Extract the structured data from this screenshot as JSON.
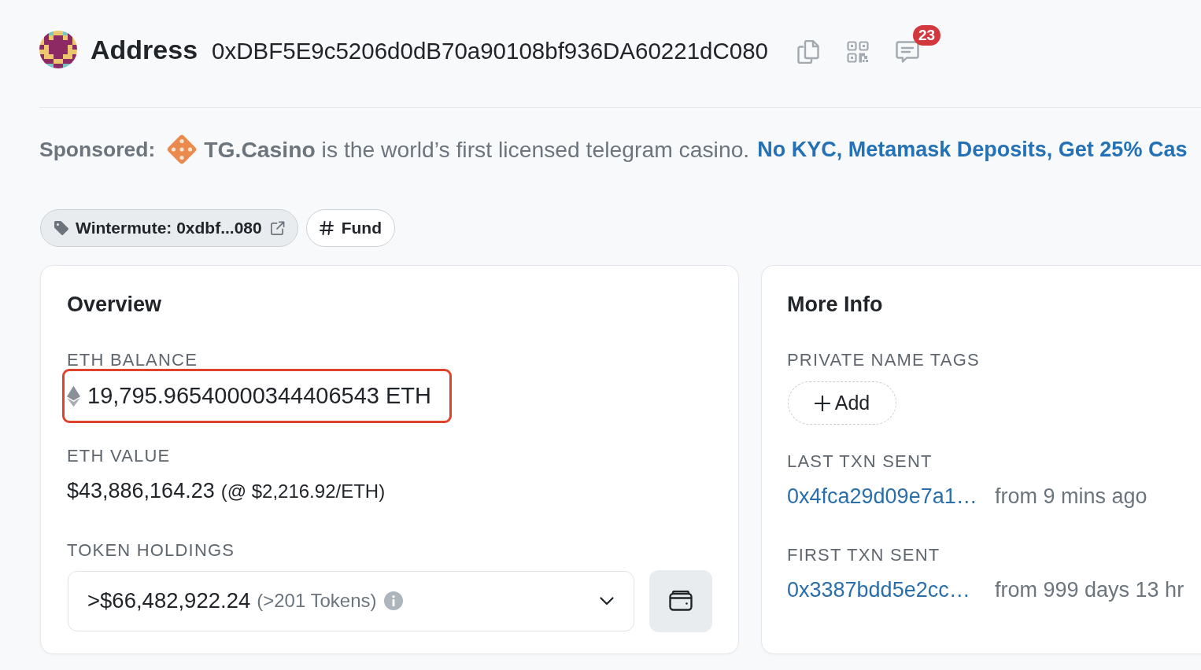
{
  "header": {
    "title": "Address",
    "address": "0xDBF5E9c5206d0dB70a90108bf936DA60221dC080",
    "notification_count": "23"
  },
  "sponsored": {
    "label": "Sponsored:",
    "text": "**TG.Casino** is the world’s first licensed telegram casino.",
    "link": "No KYC, Metamask Deposits, Get 25% Cas"
  },
  "tags": [
    {
      "kind": "name_tag",
      "label": "Wintermute: 0xdbf...080"
    },
    {
      "kind": "hashtag",
      "label": "Fund"
    }
  ],
  "overview": {
    "title": "Overview",
    "fields": [
      {
        "kind": "balance",
        "label": "ETH BALANCE",
        "value": "19,795.96540000344406543 ETH",
        "highlighted": true
      },
      {
        "kind": "value",
        "label": "ETH VALUE",
        "value": "$43,886,164.23",
        "note": "(@ $2,216.92/ETH)"
      },
      {
        "kind": "tokens",
        "label": "TOKEN HOLDINGS",
        "value": ">$66,482,922.24",
        "note": "(>201 Tokens)"
      }
    ]
  },
  "more_info": {
    "title": "More Info",
    "fields": [
      {
        "kind": "name_tags",
        "label": "PRIVATE NAME TAGS",
        "button": "Add"
      },
      {
        "kind": "txn",
        "label": "LAST TXN SENT",
        "hash": "0x4fca29d09e7a1…",
        "age": "from 9 mins ago"
      },
      {
        "kind": "txn",
        "label": "FIRST TXN SENT",
        "hash": "0x3387bdd5e2cc…",
        "age": "from 999 days 13 hr"
      }
    ]
  }
}
